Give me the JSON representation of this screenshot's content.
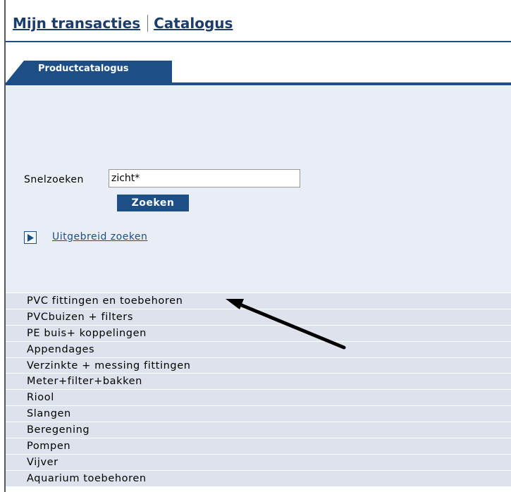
{
  "nav": {
    "my_transactions": "Mijn transacties",
    "catalog": "Catalogus"
  },
  "tab": {
    "label": "Productcatalogus"
  },
  "search": {
    "label": "Snelzoeken",
    "value": "zicht*",
    "button_label": "Zoeken",
    "advanced_link": "Uitgebreid zoeken"
  },
  "categories": [
    "PVC fittingen en toebehoren",
    "PVCbuizen + filters",
    "PE buis+ koppelingen",
    "Appendages",
    "Verzinkte + messing fittingen",
    "Meter+filter+bakken",
    "Riool",
    "Slangen",
    "Beregening",
    "Pompen",
    "Vijver",
    "Aquarium toebehoren"
  ],
  "colors": {
    "brand_blue": "#1d4f86",
    "panel_bg": "#e9edf5",
    "row_bg": "#dde2ec"
  },
  "icons": {
    "advanced_search": "play-arrow-icon",
    "annotation": "arrow-annotation"
  }
}
